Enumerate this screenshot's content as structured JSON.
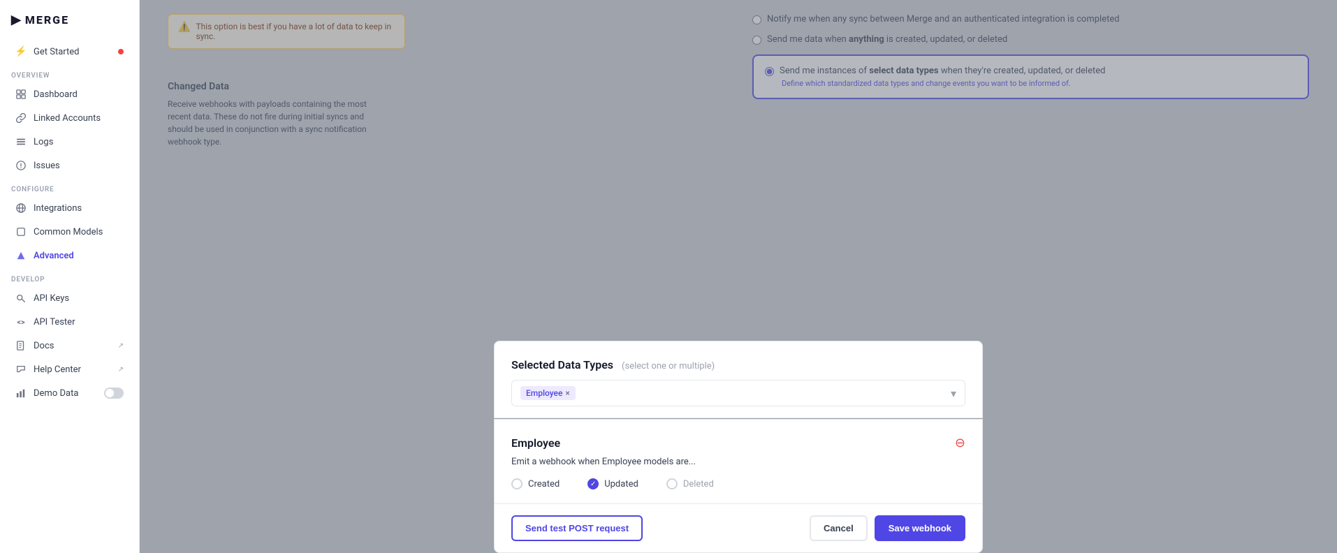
{
  "sidebar": {
    "logo": "MERGE",
    "sections": [
      {
        "label": "",
        "items": [
          {
            "id": "get-started",
            "label": "Get Started",
            "icon": "⚡",
            "badge": true
          }
        ]
      },
      {
        "label": "Overview",
        "items": [
          {
            "id": "dashboard",
            "label": "Dashboard",
            "icon": "📊"
          },
          {
            "id": "linked-accounts",
            "label": "Linked Accounts",
            "icon": "🔗"
          },
          {
            "id": "logs",
            "label": "Logs",
            "icon": "📋"
          },
          {
            "id": "issues",
            "label": "Issues",
            "icon": "⚠"
          }
        ]
      },
      {
        "label": "Configure",
        "items": [
          {
            "id": "integrations",
            "label": "Integrations",
            "icon": "🌐"
          },
          {
            "id": "common-models",
            "label": "Common Models",
            "icon": "◻"
          },
          {
            "id": "advanced",
            "label": "Advanced",
            "icon": "🔷",
            "active": true
          }
        ]
      },
      {
        "label": "Develop",
        "items": [
          {
            "id": "api-keys",
            "label": "API Keys",
            "icon": "🔑"
          },
          {
            "id": "api-tester",
            "label": "API Tester",
            "icon": "<>"
          },
          {
            "id": "docs",
            "label": "Docs",
            "icon": "📚",
            "external": true
          },
          {
            "id": "help-center",
            "label": "Help Center",
            "icon": "📈",
            "external": true
          },
          {
            "id": "demo-data",
            "label": "Demo Data",
            "icon": "📊",
            "toggle": true
          }
        ]
      }
    ]
  },
  "background": {
    "warning_text": "This option is best if you have a lot of data to keep in sync.",
    "changed_data_title": "Changed Data",
    "changed_data_desc": "Receive webhooks with payloads containing the most recent data. These do not fire during initial syncs and should be used in conjunction with a sync notification webhook type.",
    "radio_option1": "Notify me when any sync between Merge and an authenticated integration is completed",
    "radio_option2_prefix": "Send me data when ",
    "radio_option2_highlight": "anything",
    "radio_option2_suffix": " is created, updated, or deleted",
    "radio_option3_prefix": "Send me instances of ",
    "radio_option3_highlight": "select data types",
    "radio_option3_suffix": " when they're created, updated, or deleted",
    "radio_option3_sub": "Define which standardized data types and change events you want to be informed of."
  },
  "modal": {
    "selected_types_title": "Selected Data Types",
    "select_hint": "(select one or multiple)",
    "tags": [
      {
        "label": "Employee",
        "removable": true
      }
    ],
    "employee_section": {
      "title": "Employee",
      "description": "Emit a webhook when Employee models are...",
      "checkboxes": [
        {
          "label": "Created",
          "checked": false
        },
        {
          "label": "Updated",
          "checked": true
        },
        {
          "label": "Deleted",
          "checked": false
        }
      ]
    },
    "footer": {
      "send_test_label": "Send test POST request",
      "cancel_label": "Cancel",
      "save_label": "Save webhook"
    }
  }
}
